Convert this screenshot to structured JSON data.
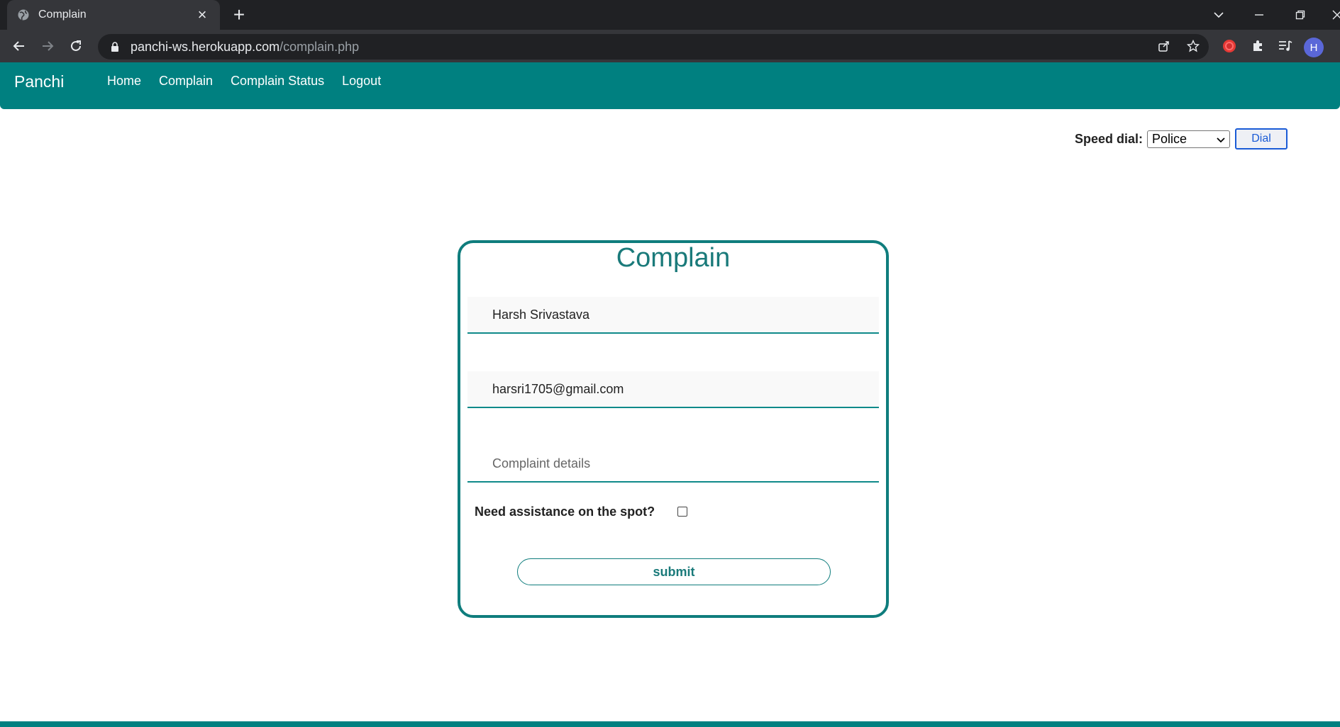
{
  "browser": {
    "tab_title": "Complain",
    "url_host": "panchi-ws.herokuapp.com",
    "url_path": "/complain.php",
    "profile_initial": "H"
  },
  "navbar": {
    "brand": "Panchi",
    "links": [
      "Home",
      "Complain",
      "Complain Status",
      "Logout"
    ]
  },
  "speed_dial": {
    "label": "Speed dial:",
    "selected": "Police",
    "button": "Dial"
  },
  "form": {
    "title": "Complain",
    "name_value": "Harsh Srivastava",
    "email_value": "harsri1705@gmail.com",
    "details_placeholder": "Complaint details",
    "assist_label": "Need assistance on the spot?",
    "submit": "submit"
  },
  "colors": {
    "brand_teal": "#008080",
    "accent_teal": "#0f7d7d"
  }
}
